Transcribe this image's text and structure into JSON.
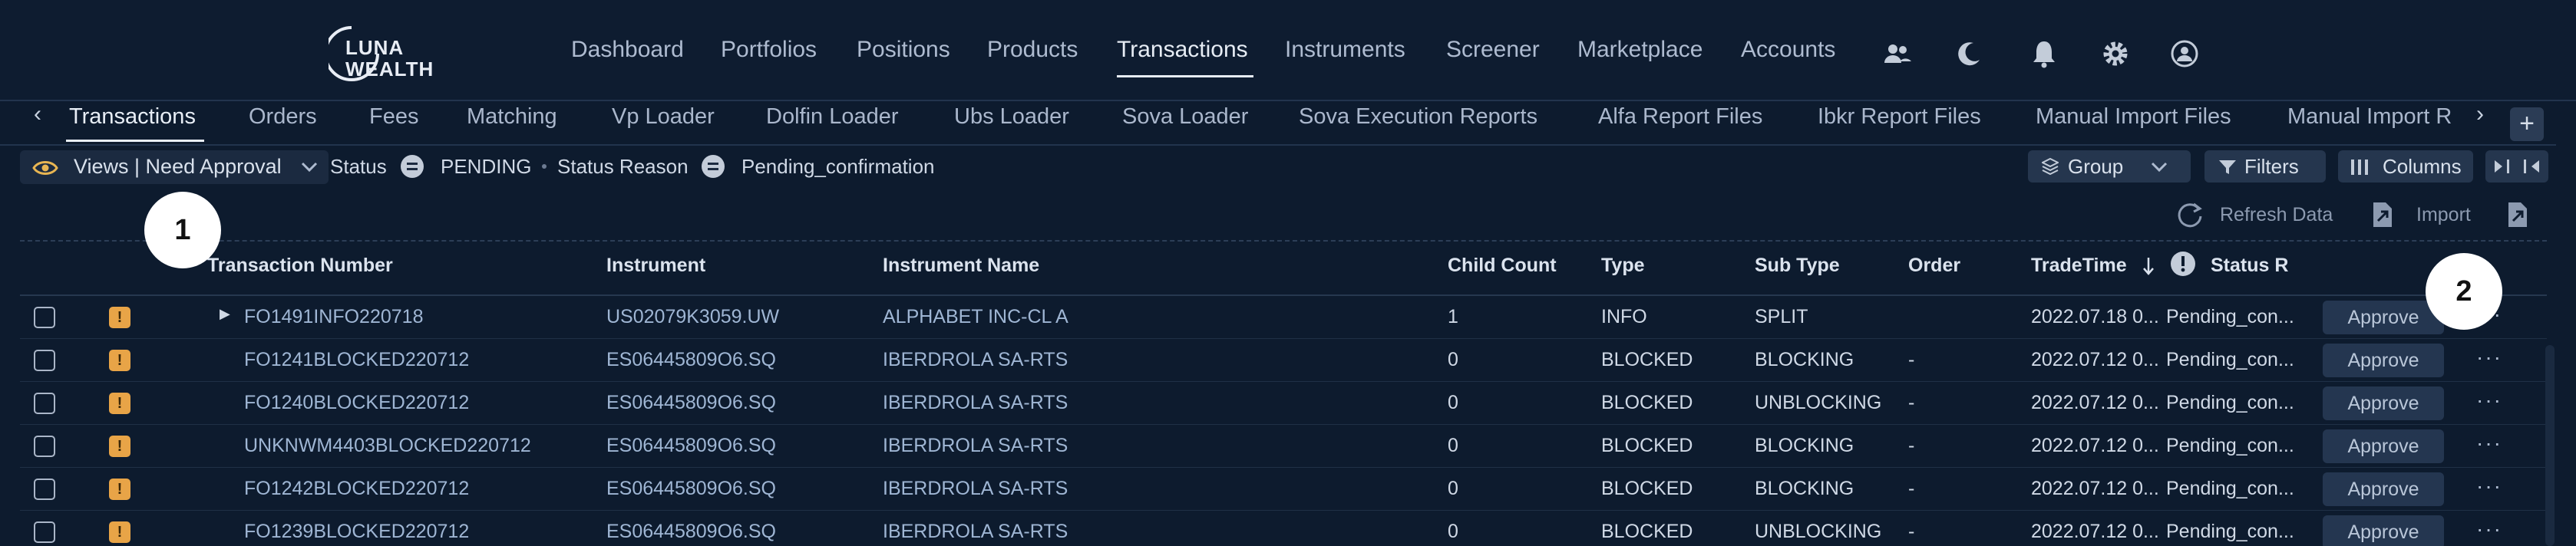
{
  "brand": {
    "line1": "LUNA",
    "line2": "WEALTH"
  },
  "nav": {
    "items": [
      "Dashboard",
      "Portfolios",
      "Positions",
      "Products",
      "Transactions",
      "Instruments",
      "Screener",
      "Marketplace",
      "Accounts"
    ],
    "active": "Transactions",
    "icons": [
      "users-icon",
      "moon-icon",
      "bell-icon",
      "gear-icon",
      "user-circle-icon"
    ]
  },
  "subtabs": {
    "items": [
      "Transactions",
      "Orders",
      "Fees",
      "Matching",
      "Vp Loader",
      "Dolfin Loader",
      "Ubs Loader",
      "Sova Loader",
      "Sova Execution Reports",
      "Alfa Report Files",
      "Ibkr Report Files",
      "Manual Import Files",
      "Manual Import R"
    ],
    "active": "Transactions",
    "add_label": "+"
  },
  "filters": {
    "views_label": "Views | Need Approval",
    "status_label": "Status",
    "status_value": "PENDING",
    "reason_label": "Status Reason",
    "reason_value": "Pending_confirmation",
    "group_label": "Group",
    "filters_label": "Filters",
    "columns_label": "Columns"
  },
  "toolbar": {
    "refresh_label": "Refresh Data",
    "import_label": "Import"
  },
  "table": {
    "headers": {
      "transaction_number": "Transaction Number",
      "instrument": "Instrument",
      "instrument_name": "Instrument Name",
      "child_count": "Child Count",
      "type": "Type",
      "sub_type": "Sub Type",
      "order": "Order",
      "trade_time": "TradeTime",
      "status_r": "Status R"
    },
    "approve_label": "Approve",
    "more_label": "···",
    "rows": [
      {
        "txn": "FO1491INFO220718",
        "instrument": "US02079K3059.UW",
        "name": "ALPHABET INC-CL A",
        "child": "1",
        "type": "INFO",
        "subtype": "SPLIT",
        "order": "",
        "time": "2022.07.18 0...",
        "status": "Pending_con...",
        "expandable": true
      },
      {
        "txn": "FO1241BLOCKED220712",
        "instrument": "ES06445809O6.SQ",
        "name": "IBERDROLA SA-RTS",
        "child": "0",
        "type": "BLOCKED",
        "subtype": "BLOCKING",
        "order": "-",
        "time": "2022.07.12 0...",
        "status": "Pending_con...",
        "expandable": false
      },
      {
        "txn": "FO1240BLOCKED220712",
        "instrument": "ES06445809O6.SQ",
        "name": "IBERDROLA SA-RTS",
        "child": "0",
        "type": "BLOCKED",
        "subtype": "UNBLOCKING",
        "order": "-",
        "time": "2022.07.12 0...",
        "status": "Pending_con...",
        "expandable": false
      },
      {
        "txn": "UNKNWM4403BLOCKED220712",
        "instrument": "ES06445809O6.SQ",
        "name": "IBERDROLA SA-RTS",
        "child": "0",
        "type": "BLOCKED",
        "subtype": "BLOCKING",
        "order": "-",
        "time": "2022.07.12 0...",
        "status": "Pending_con...",
        "expandable": false
      },
      {
        "txn": "FO1242BLOCKED220712",
        "instrument": "ES06445809O6.SQ",
        "name": "IBERDROLA SA-RTS",
        "child": "0",
        "type": "BLOCKED",
        "subtype": "BLOCKING",
        "order": "-",
        "time": "2022.07.12 0...",
        "status": "Pending_con...",
        "expandable": false
      },
      {
        "txn": "FO1239BLOCKED220712",
        "instrument": "ES06445809O6.SQ",
        "name": "IBERDROLA SA-RTS",
        "child": "0",
        "type": "BLOCKED",
        "subtype": "UNBLOCKING",
        "order": "-",
        "time": "2022.07.12 0...",
        "status": "Pending_con...",
        "expandable": false
      }
    ]
  },
  "callouts": [
    "1",
    "2"
  ],
  "colors": {
    "background": "#0d1b2e",
    "warning": "#e8a447",
    "button": "#243650"
  }
}
